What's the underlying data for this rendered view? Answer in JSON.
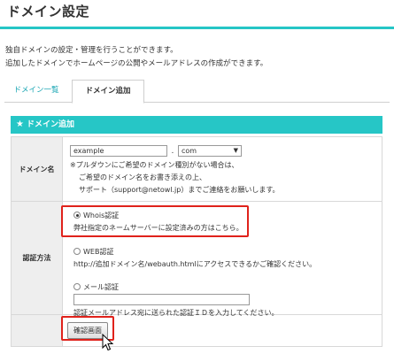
{
  "page": {
    "title": "ドメイン設定",
    "description_lines": [
      "独自ドメインの設定・管理を行うことができます。",
      "追加したドメインでホームページの公開やメールアドレスの作成ができます。"
    ]
  },
  "tabs": [
    {
      "label": "ドメイン一覧",
      "active": false
    },
    {
      "label": "ドメイン追加",
      "active": true
    }
  ],
  "panel": {
    "title": "ドメイン追加",
    "icon": "star-icon"
  },
  "domain_row": {
    "label": "ドメイン名",
    "domain_input_value": "example",
    "separator": ".",
    "tld_selected": "com",
    "notes": [
      "※プルダウンにご希望のドメイン種別がない場合は、",
      "ご希望のドメイン名をお書き添えの上、",
      "サポート（support@netowl.jp）までご連絡をお願いします。"
    ]
  },
  "auth_row": {
    "label": "認証方法",
    "options": [
      {
        "label": "Whois認証",
        "desc": "弊社指定のネームサーバーに設定済みの方はこちら。",
        "selected": true
      },
      {
        "label": "WEB認証",
        "desc": "http://追加ドメイン名/webauth.htmlにアクセスできるかご確認ください。",
        "selected": false
      },
      {
        "label": "メール認証",
        "desc": "認証メールアドレス宛に送られた認証ＩＤを入力してください。",
        "selected": false
      }
    ],
    "mail_input_value": ""
  },
  "confirm_button_label": "確認画面",
  "colors": {
    "accent": "#26c6c6",
    "highlight": "#e0221b",
    "link": "#1aa6b4"
  }
}
